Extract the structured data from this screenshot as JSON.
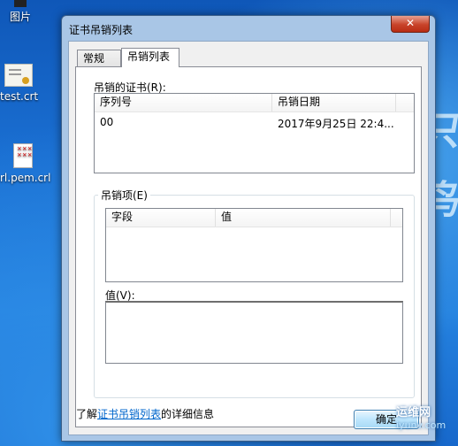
{
  "desktop": {
    "icons": [
      {
        "label": "图片"
      },
      {
        "label": "test.crt"
      },
      {
        "label": "rl.pem.crl"
      }
    ],
    "watermark_text": "运维网",
    "watermark_sub": "iyunv.com"
  },
  "window": {
    "title": "证书吊销列表",
    "close_label": "✕",
    "tabs": [
      {
        "label": "常规",
        "active": false
      },
      {
        "label": "吊销列表",
        "active": true
      }
    ],
    "revoked_certs": {
      "label": "吊销的证书(R):",
      "columns": [
        "序列号",
        "吊销日期"
      ],
      "rows": [
        {
          "serial": "00",
          "date": "2017年9月25日 22:4..."
        }
      ]
    },
    "revocation_entry": {
      "label": "吊销项(E)",
      "columns": [
        "字段",
        "值"
      ],
      "value_label": "值(V):"
    },
    "learn_more": {
      "prefix": "了解",
      "link": "证书吊销列表",
      "suffix": "的详细信息"
    },
    "ok_label": "确定"
  }
}
